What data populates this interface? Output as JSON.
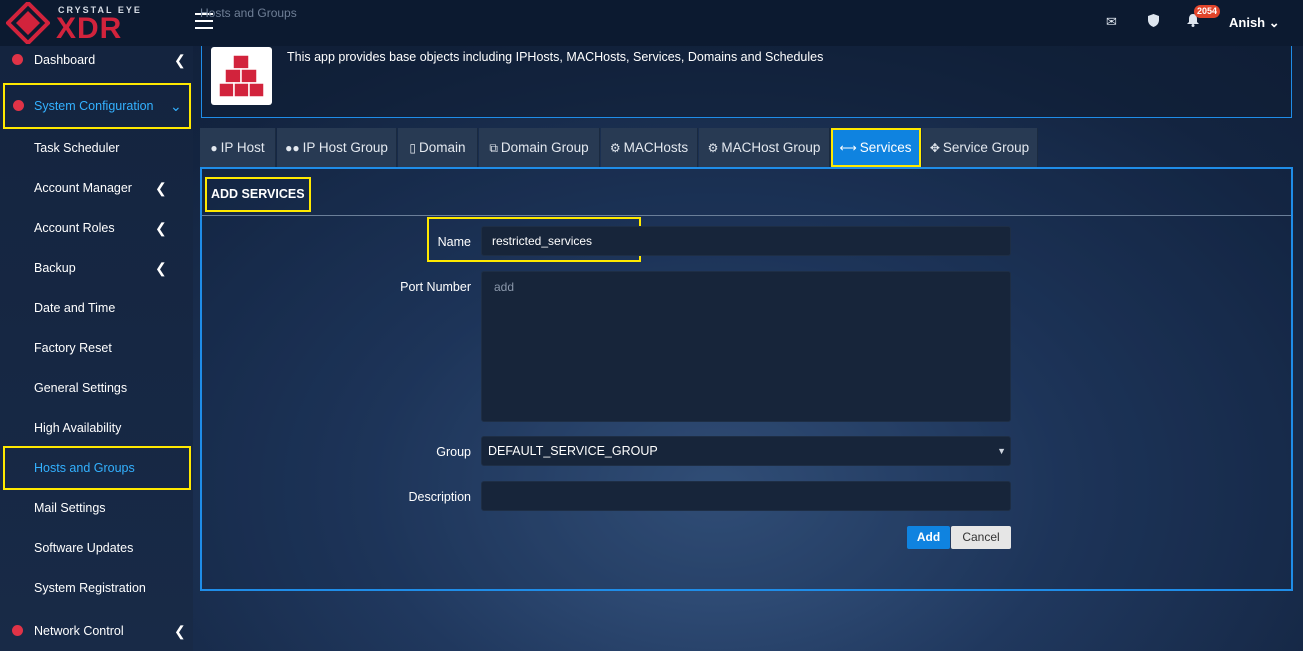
{
  "brand": {
    "tagline": "CRYSTAL EYE",
    "name": "XDR"
  },
  "header": {
    "breadcrumb": "Hosts and Groups",
    "notification_count": "2054",
    "user": "Anish"
  },
  "sidebar": {
    "items": [
      {
        "label": "Dashboard"
      },
      {
        "label": "System Configuration"
      },
      {
        "label": "Task Scheduler"
      },
      {
        "label": "Account Manager"
      },
      {
        "label": "Account Roles"
      },
      {
        "label": "Backup"
      },
      {
        "label": "Date and Time"
      },
      {
        "label": "Factory Reset"
      },
      {
        "label": "General Settings"
      },
      {
        "label": "High Availability"
      },
      {
        "label": "Hosts and Groups"
      },
      {
        "label": "Mail Settings"
      },
      {
        "label": "Software Updates"
      },
      {
        "label": "System Registration"
      },
      {
        "label": "Network Control"
      }
    ]
  },
  "app": {
    "description": "This app provides base objects including IPHosts, MACHosts, Services, Domains and Schedules"
  },
  "tabs": [
    {
      "label": "IP Host"
    },
    {
      "label": "IP Host Group"
    },
    {
      "label": "Domain"
    },
    {
      "label": "Domain Group"
    },
    {
      "label": "MACHosts"
    },
    {
      "label": "MACHost Group"
    },
    {
      "label": "Services"
    },
    {
      "label": "Service Group"
    }
  ],
  "form": {
    "title": "ADD SERVICES",
    "name_label": "Name",
    "name_value": "restricted_services",
    "port_label": "Port Number",
    "port_placeholder": "add",
    "group_label": "Group",
    "group_value": "DEFAULT_SERVICE_GROUP",
    "description_label": "Description",
    "description_value": "",
    "add_label": "Add",
    "cancel_label": "Cancel"
  },
  "colors": {
    "accent": "#0f83e0",
    "highlight": "#ffe900",
    "brand_red": "#d2233c"
  }
}
